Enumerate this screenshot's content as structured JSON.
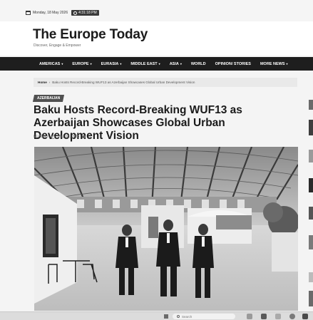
{
  "topbar": {
    "date": "Monday, 18 May 2026",
    "time": "4:31:18 PM"
  },
  "site": {
    "title": "The Europe Today",
    "tagline": "Discover, Engage & Empower"
  },
  "nav": {
    "items": [
      {
        "label": "AMERICAS",
        "has_caret": true
      },
      {
        "label": "EUROPE",
        "has_caret": true
      },
      {
        "label": "EURASIA",
        "has_caret": true
      },
      {
        "label": "MIDDLE EAST",
        "has_caret": true
      },
      {
        "label": "ASIA",
        "has_caret": true
      },
      {
        "label": "WORLD",
        "has_caret": false
      },
      {
        "label": "OPINION/ STORIES",
        "has_caret": false
      },
      {
        "label": "MORE NEWS",
        "has_caret": true
      }
    ]
  },
  "breadcrumb": {
    "home": "Home",
    "separator": "›",
    "current": "Baku Hosts Record-Breaking WUF13 as Azerbaijan Showcases Global Urban Development Vision"
  },
  "article": {
    "category": "AZERBAIJAN",
    "title": "Baku Hosts Record-Breaking WUF13 as Azerbaijan Showcases Global Urban Development Vision",
    "author": "EU News",
    "date": "May 18, 2026",
    "comments": "0"
  },
  "taskbar": {
    "search_placeholder": "Search"
  }
}
